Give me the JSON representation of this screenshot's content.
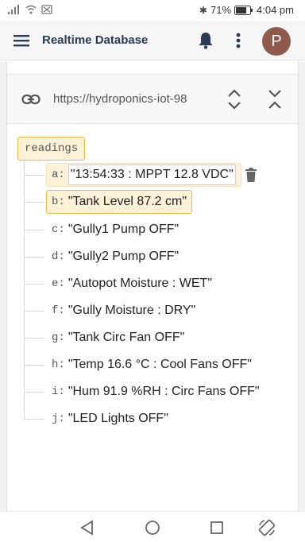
{
  "status": {
    "battery": "71%",
    "time": "4:04 pm"
  },
  "appbar": {
    "title": "Realtime Database",
    "avatar_letter": "P"
  },
  "url": {
    "text": "https://hydroponics-iot-98"
  },
  "root": {
    "key": "readings"
  },
  "rows": [
    {
      "key": "a:",
      "value": "\"13:54:33 : MPPT 12.8 VDC\""
    },
    {
      "key": "b:",
      "value": "\"Tank Level 87.2 cm\""
    },
    {
      "key": "c:",
      "value": "\"Gully1 Pump OFF\""
    },
    {
      "key": "d:",
      "value": "\"Gully2 Pump OFF\""
    },
    {
      "key": "e:",
      "value": "\"Autopot Moisture : WET\""
    },
    {
      "key": "f:",
      "value": "\"Gully Moisture : DRY\""
    },
    {
      "key": "g:",
      "value": "\"Tank Circ Fan OFF\""
    },
    {
      "key": "h:",
      "value": "\"Temp 16.6 °C : Cool Fans OFF\""
    },
    {
      "key": "i:",
      "value": "\"Hum 91.9 %RH : Circ Fans OFF\""
    },
    {
      "key": "j:",
      "value": "\"LED Lights OFF\""
    }
  ],
  "icons": {
    "menu": "hamburger-icon",
    "bell": "bell-icon",
    "more": "more-vert-icon",
    "link": "link-icon",
    "expand": "unfold-more-icon",
    "collapse": "unfold-less-icon",
    "delete": "trash-icon",
    "back": "back-triangle-icon",
    "home": "home-circle-icon",
    "recents": "recents-square-icon",
    "rotate": "rotate-icon"
  },
  "colors": {
    "accent": "#f2b743",
    "selected_bg": "#fdf1d8",
    "avatar": "#8d5a4b",
    "title": "#2b3a55"
  }
}
